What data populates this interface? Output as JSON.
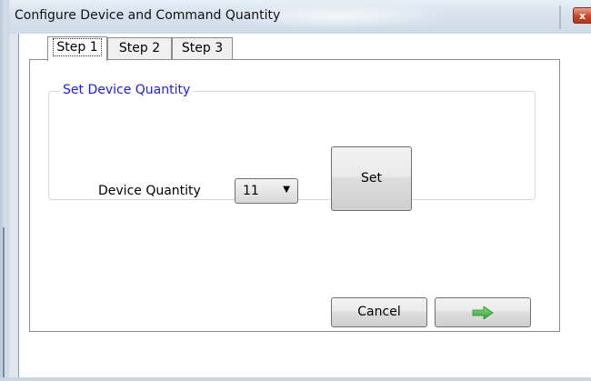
{
  "window": {
    "title": "Configure Device and Command Quantity",
    "close_glyph": "x"
  },
  "tabs": [
    {
      "label": "Step 1",
      "active": true
    },
    {
      "label": "Step 2",
      "active": false
    },
    {
      "label": "Step 3",
      "active": false
    }
  ],
  "group": {
    "title": "Set Device Quantity"
  },
  "device_quantity": {
    "label": "Device Quantity",
    "selected": "11"
  },
  "buttons": {
    "set_label": "Set",
    "cancel_label": "Cancel",
    "next_icon": "green-right-arrow-icon"
  },
  "colors": {
    "group_title": "#1a1aff",
    "next_arrow": "#3cb84a",
    "close_button": "#c7472b"
  }
}
